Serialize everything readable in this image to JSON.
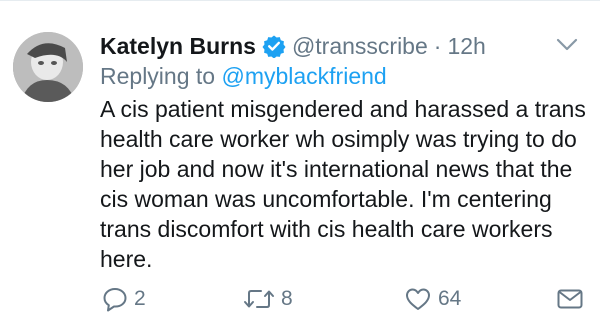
{
  "tweet": {
    "author_name": "Katelyn Burns",
    "handle": "@transscribe",
    "separator": "·",
    "time": "12h",
    "replying_prefix": "Replying to",
    "replying_to": "@myblackfriend",
    "text": "A cis patient misgendered and harassed a trans health care worker wh osimply was trying to do her job and now it's international news that the cis woman was uncomfortable. I'm centering trans discomfort with cis health care workers here.",
    "verified": true
  },
  "actions": {
    "reply_count": "2",
    "retweet_count": "8",
    "like_count": "64"
  },
  "icons": {
    "verified": "verified-badge-icon",
    "chevron": "chevron-down-icon",
    "reply": "reply-bubble-icon",
    "retweet": "retweet-icon",
    "like": "heart-icon",
    "dm": "envelope-icon"
  },
  "colors": {
    "accent": "#1da1f2",
    "secondary_text": "#657786",
    "primary_text": "#14171a"
  }
}
